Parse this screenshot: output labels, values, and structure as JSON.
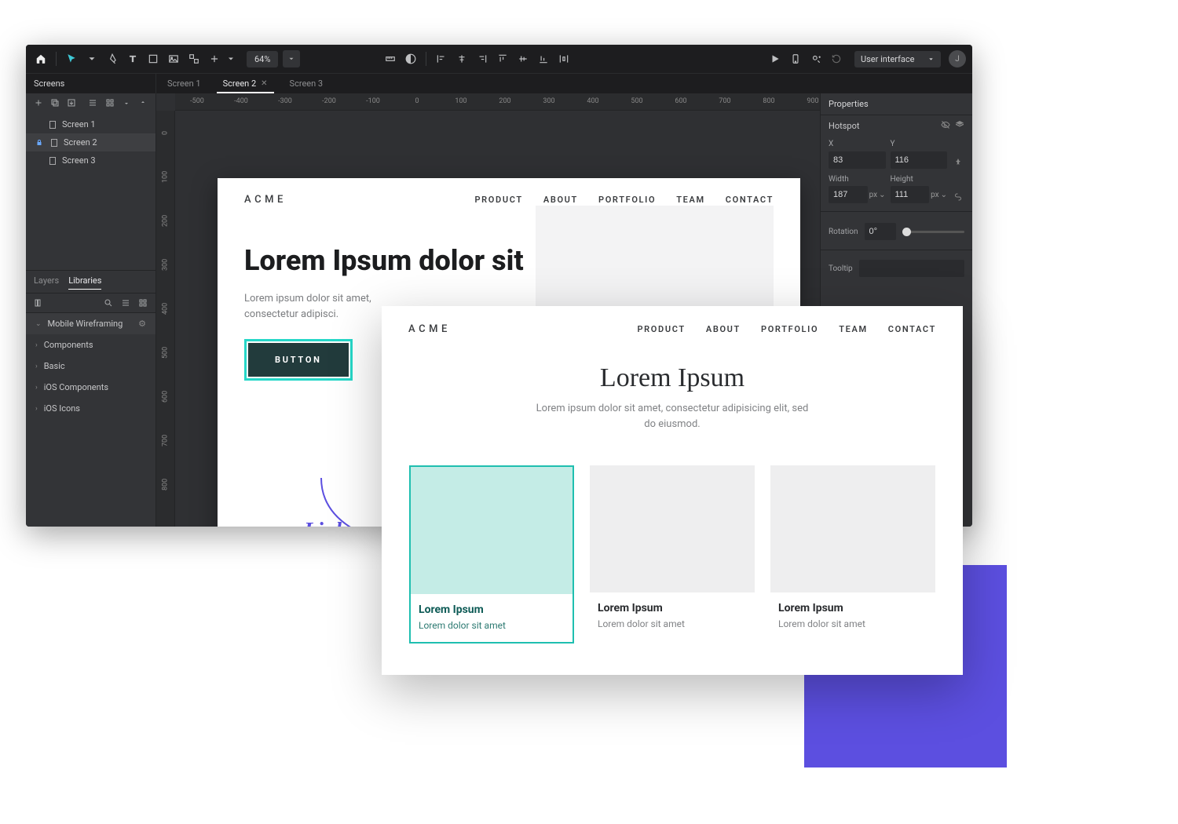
{
  "toolbar": {
    "zoom": "64%",
    "library_select": "User interface",
    "avatar_initial": "J"
  },
  "left_panel": {
    "header": "Screens",
    "screens": [
      "Screen 1",
      "Screen 2",
      "Screen 3"
    ],
    "tabs": [
      "Layers",
      "Libraries"
    ],
    "library_groups": [
      "Mobile Wireframing",
      "Components",
      "Basic",
      "iOS Components",
      "iOS Icons"
    ]
  },
  "document_tabs": [
    "Screen 1",
    "Screen 2",
    "Screen 3"
  ],
  "ruler_h": [
    "-500",
    "-400",
    "-300",
    "-200",
    "-100",
    "0",
    "100",
    "200",
    "300",
    "400",
    "500",
    "600",
    "700",
    "800",
    "900"
  ],
  "ruler_v": [
    "0",
    "100",
    "200",
    "300",
    "400",
    "500",
    "600",
    "700",
    "800"
  ],
  "artboard1": {
    "brand": "ACME",
    "nav": [
      "PRODUCT",
      "ABOUT",
      "PORTFOLIO",
      "TEAM",
      "CONTACT"
    ],
    "hero_title": "Lorem Ipsum dolor sit",
    "hero_sub": "Lorem ipsum dolor sit amet, consectetur adipisci.",
    "button_label": "BUTTON",
    "link_label": "Link"
  },
  "preview": {
    "brand": "ACME",
    "nav": [
      "PRODUCT",
      "ABOUT",
      "PORTFOLIO",
      "TEAM",
      "CONTACT"
    ],
    "title": "Lorem Ipsum",
    "sub": "Lorem ipsum dolor sit amet, consectetur adipisicing elit, sed do eiusmod.",
    "cards": [
      {
        "title": "Lorem Ipsum",
        "sub": "Lorem dolor sit amet"
      },
      {
        "title": "Lorem Ipsum",
        "sub": "Lorem dolor sit amet"
      },
      {
        "title": "Lorem Ipsum",
        "sub": "Lorem dolor sit amet"
      }
    ]
  },
  "properties": {
    "header": "Properties",
    "hotspot_label": "Hotspot",
    "x_label": "X",
    "x_value": "83",
    "y_label": "Y",
    "y_value": "116",
    "width_label": "Width",
    "width_value": "187",
    "width_unit": "px",
    "height_label": "Height",
    "height_value": "111",
    "height_unit": "px",
    "rotation_label": "Rotation",
    "rotation_value": "0°",
    "tooltip_label": "Tooltip",
    "tooltip_value": ""
  }
}
